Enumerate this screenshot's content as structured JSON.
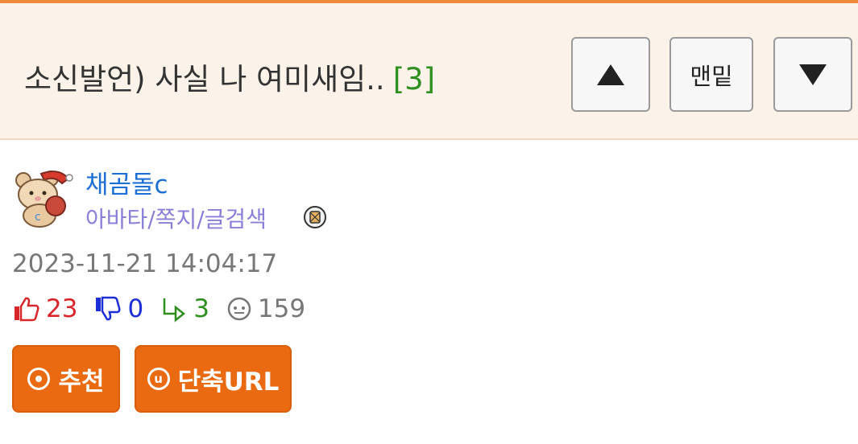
{
  "post": {
    "title": "소신발언) 사실 나 여미새임..",
    "comment_count": "[3]"
  },
  "nav": {
    "up_icon": "triangle-up-icon",
    "bottom_label": "맨밑",
    "down_icon": "triangle-down-icon"
  },
  "author": {
    "name": "채곰돌c",
    "links": "아바타/쪽지/글검색",
    "avatar_icon": "teddy-bear-santa-avatar",
    "badge_icon": "letter-badge-icon"
  },
  "meta": {
    "date": "2023-11-21 14:04:17"
  },
  "stats": {
    "likes": "23",
    "dislikes": "0",
    "replies": "3",
    "views": "159"
  },
  "actions": {
    "recommend_label": "추천",
    "shorturl_icon_letter": "u",
    "shorturl_label": "단축URL"
  },
  "colors": {
    "header_bg": "#fbf2ea",
    "accent_orange": "#ea6a12",
    "author_blue": "#1d6fd6",
    "link_purple": "#8a7fd8",
    "like_red": "#d9262a",
    "dislike_blue": "#1c2fd6",
    "reply_green": "#2f8f1f"
  }
}
